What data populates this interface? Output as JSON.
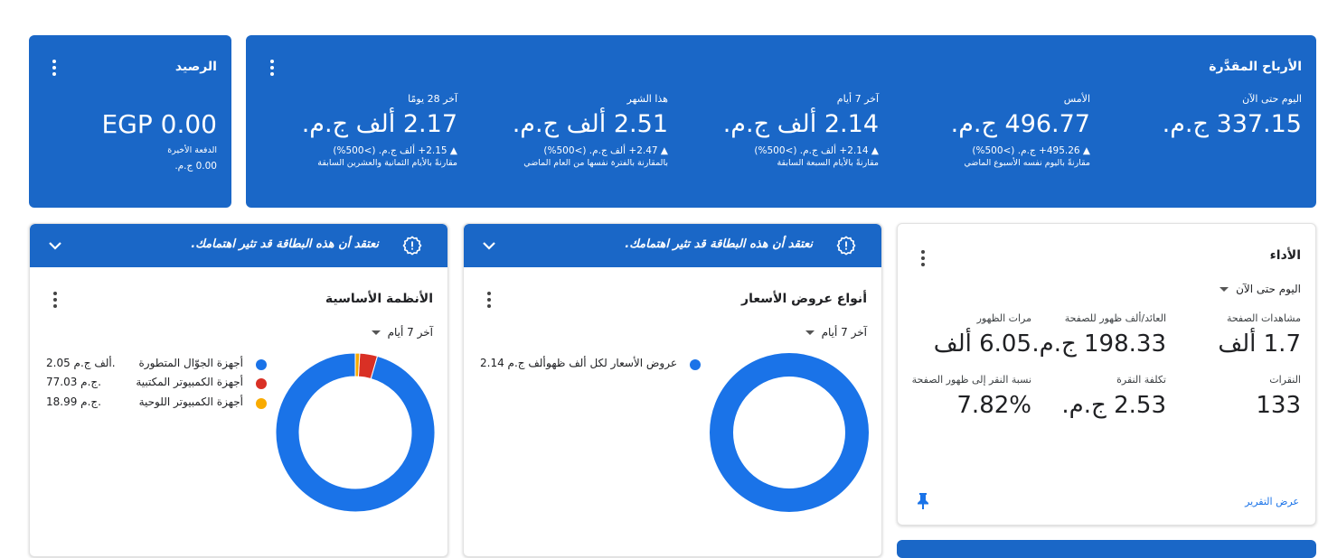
{
  "balance": {
    "title": "الرصيد",
    "amount": "EGP 0.00",
    "last_payment_label": "الدفعة الأخيرة",
    "last_payment_value": "0.00 ج.م."
  },
  "earnings": {
    "title": "الأرباح المقدَّرة",
    "metrics": [
      {
        "label": "اليوم حتى الآن",
        "value": "337.15 ج.م.",
        "delta": "",
        "compare": ""
      },
      {
        "label": "الأمس",
        "value": "496.77 ج.م.",
        "delta": "▲ ‎+495.26 ج.م. (>500%)",
        "compare": "مقارنةً باليوم نفسه الأسبوع الماضي"
      },
      {
        "label": "آخر 7 أيام",
        "value": "2.14 ألف ج.م.",
        "delta": "▲ ‎+2.14 ألف ج.م. (>500%)",
        "compare": "مقارنةً بالأيام السبعة السابقة"
      },
      {
        "label": "هذا الشهر",
        "value": "2.51 ألف ج.م.",
        "delta": "▲ ‎+2.47 ألف ج.م. (>500%)",
        "compare": "بالمقارنة بالفترة نفسها من العام الماضي"
      },
      {
        "label": "آخر 28 يومًا",
        "value": "2.17 ألف ج.م.",
        "delta": "▲ ‎+2.15 ألف ج.م. (>500%)",
        "compare": "مقارنةً بالأيام الثمانية والعشرين السابقة"
      }
    ]
  },
  "banner_text": "نعتقد أن هذه البطاقة قد تثير اهتمامك.",
  "platforms_card": {
    "title": "الأنظمة الأساسية",
    "range": "آخر 7 أيام",
    "legend": [
      {
        "label": "أجهزة الجوّال المتطورة",
        "value": "2.05 ألف ج.م.",
        "color": "#1a73e8"
      },
      {
        "label": "أجهزة الكمبيوتر المكتبية",
        "value": "77.03 ج.م.",
        "color": "#d93025"
      },
      {
        "label": "أجهزة الكمبيوتر اللوحية",
        "value": "18.99 ج.م.",
        "color": "#f9ab00"
      }
    ]
  },
  "pricing_card": {
    "title": "أنواع عروض الأسعار",
    "range": "آخر 7 أيام",
    "legend": [
      {
        "label": "عروض الأسعار لكل ألف ظهو...",
        "value": "2.14 ألف ج.م.",
        "color": "#1a73e8"
      }
    ]
  },
  "performance": {
    "title": "الأداء",
    "range": "اليوم حتى الآن",
    "metrics": [
      {
        "label": "مشاهدات الصفحة",
        "value": "1.7 ألف"
      },
      {
        "label": "العائد/ألف ظهور للصفحة",
        "value": "198.33 ج.م."
      },
      {
        "label": "مرات الظهور",
        "value": "6.05 ألف"
      },
      {
        "label": "النقرات",
        "value": "133"
      },
      {
        "label": "تكلفة النقرة",
        "value": "2.53 ج.م."
      },
      {
        "label": "نسبة النقر إلى ظهور الصفحة",
        "value": "7.82%"
      }
    ],
    "report_link": "عرض التقرير"
  },
  "chart_data": [
    {
      "type": "pie",
      "categories": [
        "أجهزة الجوّال المتطورة",
        "أجهزة الكمبيوتر المكتبية",
        "أجهزة الكمبيوتر اللوحية"
      ],
      "values": [
        2050,
        77.03,
        18.99
      ],
      "colors": [
        "#1a73e8",
        "#d93025",
        "#f9ab00"
      ]
    },
    {
      "type": "pie",
      "categories": [
        "عروض الأسعار لكل ألف ظهو..."
      ],
      "values": [
        2140
      ],
      "colors": [
        "#1a73e8"
      ]
    }
  ],
  "colors": {
    "primary_blue": "#1a67c7",
    "link": "#1a73e8"
  }
}
